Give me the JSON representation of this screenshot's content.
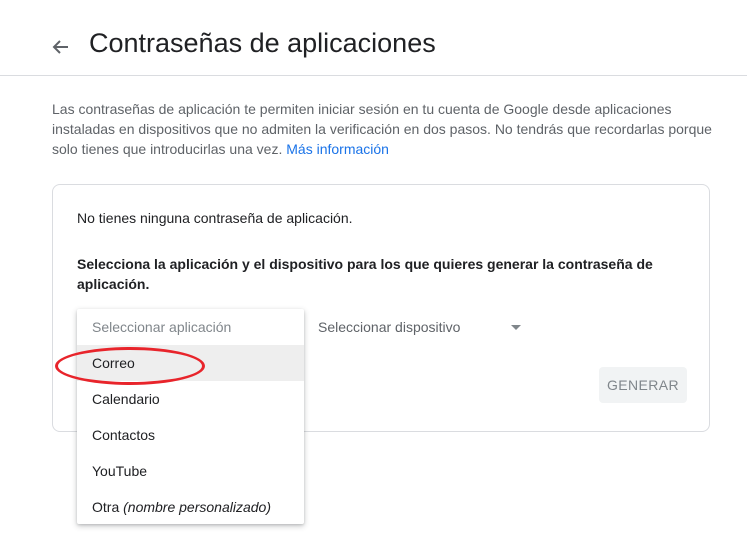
{
  "header": {
    "title": "Contraseñas de aplicaciones"
  },
  "description": {
    "text": "Las contraseñas de aplicación te permiten iniciar sesión en tu cuenta de Google desde aplicaciones instaladas en dispositivos que no admiten la verificación en dos pasos. No tendrás que recordarlas porque solo tienes que introducirlas una vez. ",
    "link": "Más información"
  },
  "card": {
    "no_passwords": "No tienes ninguna contraseña de aplicación.",
    "instruction": "Selecciona la aplicación y el dispositivo para los que quieres generar la contraseña de aplicación.",
    "device_select": "Seleccionar dispositivo",
    "generate_button": "GENERAR"
  },
  "app_menu": {
    "placeholder": "Seleccionar aplicación",
    "items": [
      "Correo",
      "Calendario",
      "Contactos",
      "YouTube"
    ],
    "other_prefix": "Otra ",
    "other_suffix": "(nombre personalizado)",
    "highlighted": "Correo"
  },
  "colors": {
    "link": "#1a73e8",
    "annotation": "#e8242b",
    "highlight": "#eeeeee"
  }
}
